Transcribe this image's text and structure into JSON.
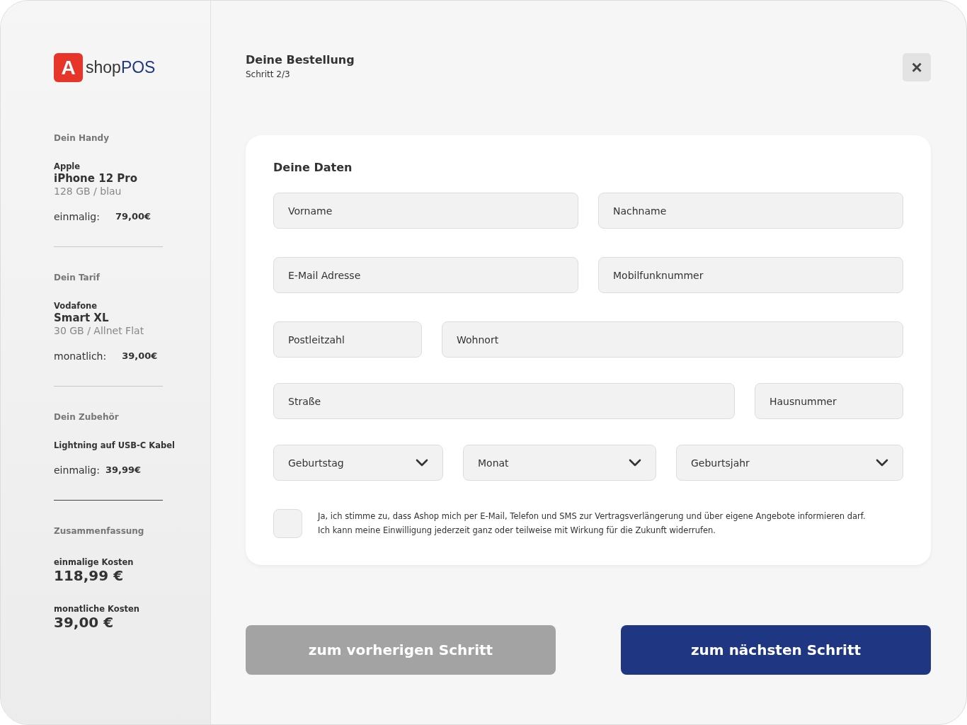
{
  "logo": {
    "mark": "A",
    "text": "shop",
    "accent": "POS"
  },
  "sidebar": {
    "sections": [
      {
        "heading": "Dein Handy",
        "brand": "Apple",
        "name": "iPhone 12 Pro",
        "detail": "128 GB / blau",
        "price_label": "einmalig:",
        "price": "79,00€"
      },
      {
        "heading": "Dein Tarif",
        "brand": "Vodafone",
        "name": "Smart XL",
        "detail": "30 GB / Allnet Flat",
        "price_label": "monatlich:",
        "price": "39,00€"
      },
      {
        "heading": "Dein Zubehör",
        "brand": "Lightning auf USB-C Kabel",
        "price_label": "einmalig:",
        "price": "39,99€"
      }
    ],
    "summary": {
      "heading": "Zusammenfassung",
      "items": [
        {
          "label": "einmalige Kosten",
          "amount": "118,99 €"
        },
        {
          "label": "monatliche Kosten",
          "amount": "39,00 €"
        }
      ]
    }
  },
  "header": {
    "title": "Deine Bestellung",
    "step": "Schritt 2/3",
    "close": "×"
  },
  "form": {
    "title": "Deine Daten",
    "rows": [
      [
        {
          "kind": "text",
          "placeholder": "Vorname"
        },
        {
          "kind": "text",
          "placeholder": "Nachname"
        }
      ],
      [
        {
          "kind": "text",
          "placeholder": "E-Mail Adresse"
        },
        {
          "kind": "text",
          "placeholder": "Mobilfunknummer"
        }
      ],
      [
        {
          "kind": "short",
          "placeholder": "Postleitzahl"
        },
        {
          "kind": "long",
          "placeholder": "Wohnort"
        }
      ],
      [
        {
          "kind": "long",
          "placeholder": "Straße"
        },
        {
          "kind": "short",
          "placeholder": "Hausnummer"
        }
      ],
      [
        {
          "kind": "select",
          "placeholder": "Geburtstag"
        },
        {
          "kind": "select",
          "placeholder": "Monat"
        },
        {
          "kind": "select",
          "placeholder": "Geburtsjahr"
        }
      ]
    ],
    "consent": {
      "checked": false,
      "lines": [
        "Ja, ich stimme zu, dass Ashop mich per E-Mail, Telefon und SMS zur Vertragsverlängerung und über eigene Angebote informieren darf.",
        "Ich kann meine Einwilligung jederzeit ganz oder teilweise mit Wirkung für die Zukunft widerrufen."
      ]
    }
  },
  "buttons": [
    {
      "kind": "secondary",
      "label": "zum vorherigen Schritt"
    },
    {
      "kind": "primary",
      "label": "zum nächsten Schritt"
    }
  ]
}
